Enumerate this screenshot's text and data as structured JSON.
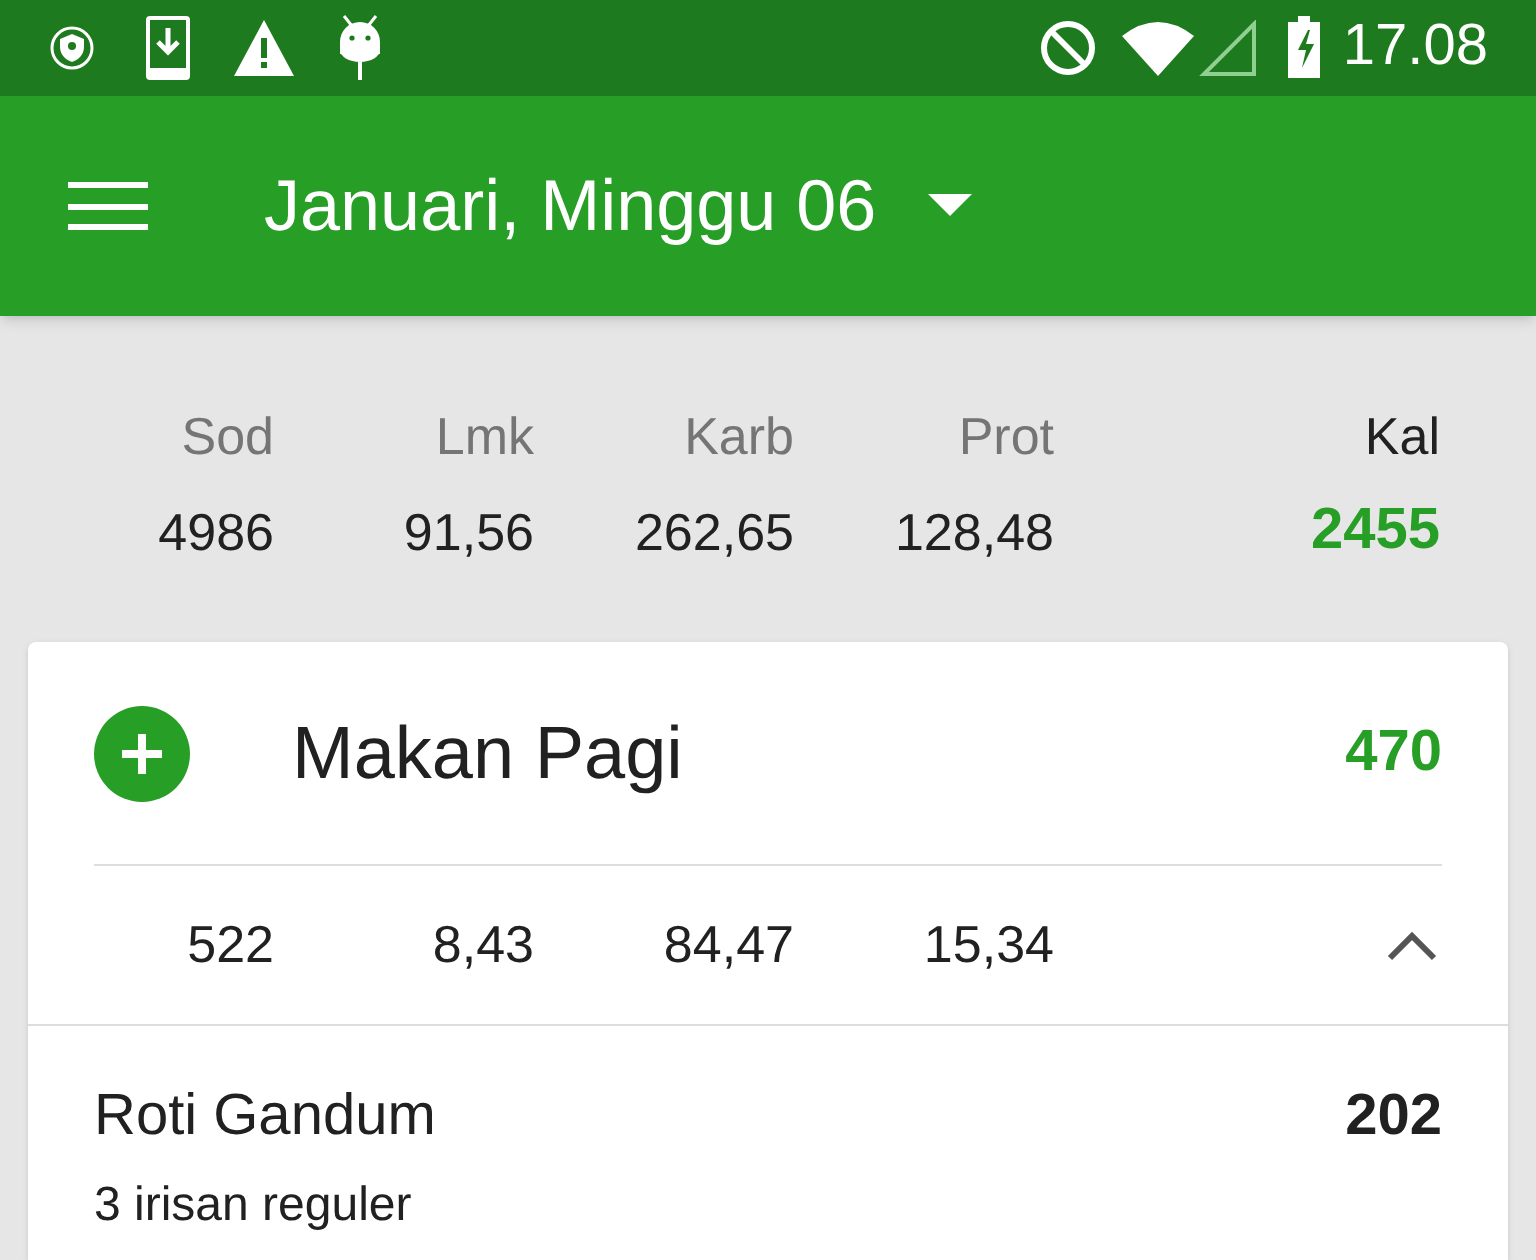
{
  "status_bar": {
    "time": "17.08"
  },
  "app_bar": {
    "title": "Januari, Minggu 06"
  },
  "summary": {
    "columns": [
      {
        "label": "Sod",
        "value": "4986"
      },
      {
        "label": "Lmk",
        "value": "91,56"
      },
      {
        "label": "Karb",
        "value": "262,65"
      },
      {
        "label": "Prot",
        "value": "128,48"
      }
    ],
    "total": {
      "label": "Kal",
      "value": "2455"
    }
  },
  "meal": {
    "title": "Makan Pagi",
    "calories": "470",
    "expanded": true,
    "nutrients": [
      "522",
      "8,43",
      "84,47",
      "15,34"
    ],
    "items": [
      {
        "name": "Roti Gandum",
        "calories": "202",
        "portion": "3 irisan reguler"
      }
    ]
  }
}
